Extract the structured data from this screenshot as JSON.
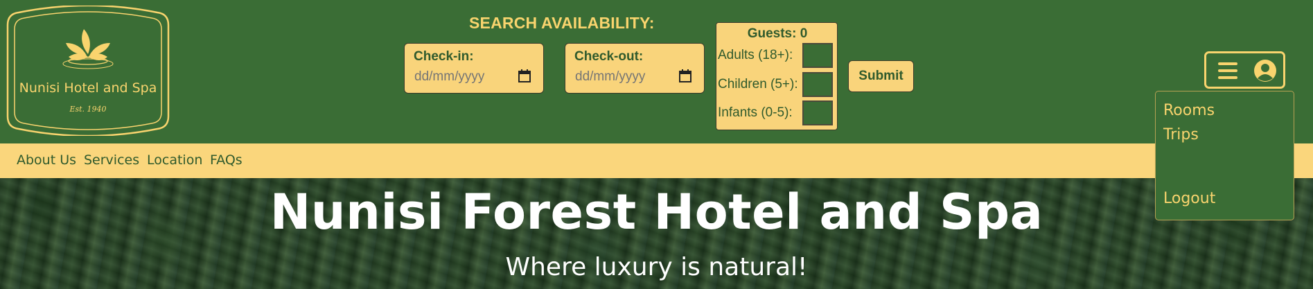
{
  "logo": {
    "name": "Nunisi Hotel and Spa",
    "established": "Est. 1940"
  },
  "search": {
    "title": "SEARCH AVAILABILITY:",
    "check_in_label": "Check-in:",
    "check_in_placeholder": "dd/mm/yyyy",
    "check_out_label": "Check-out:",
    "check_out_placeholder": "dd/mm/yyyy",
    "guests_title": "Guests: 0",
    "adults_label": "Adults (18+):",
    "children_label": "Children (5+):",
    "infants_label": "Infants (0-5):",
    "submit_label": "Submit"
  },
  "nav": {
    "items": [
      "About Us",
      "Services",
      "Location",
      "FAQs"
    ]
  },
  "hero": {
    "title": "Nunisi Forest Hotel and Spa",
    "subtitle": "Where luxury is natural!"
  },
  "dropdown": {
    "items": [
      "Rooms",
      "Trips",
      "Logout"
    ]
  },
  "icons": {
    "menu": "hamburger-icon",
    "user": "user-icon",
    "calendar": "calendar-icon",
    "logo": "leaf-lotus-icon"
  },
  "colors": {
    "primary_green": "#3a6d35",
    "accent_gold": "#f9d46e",
    "nav_background": "#fad67c"
  }
}
